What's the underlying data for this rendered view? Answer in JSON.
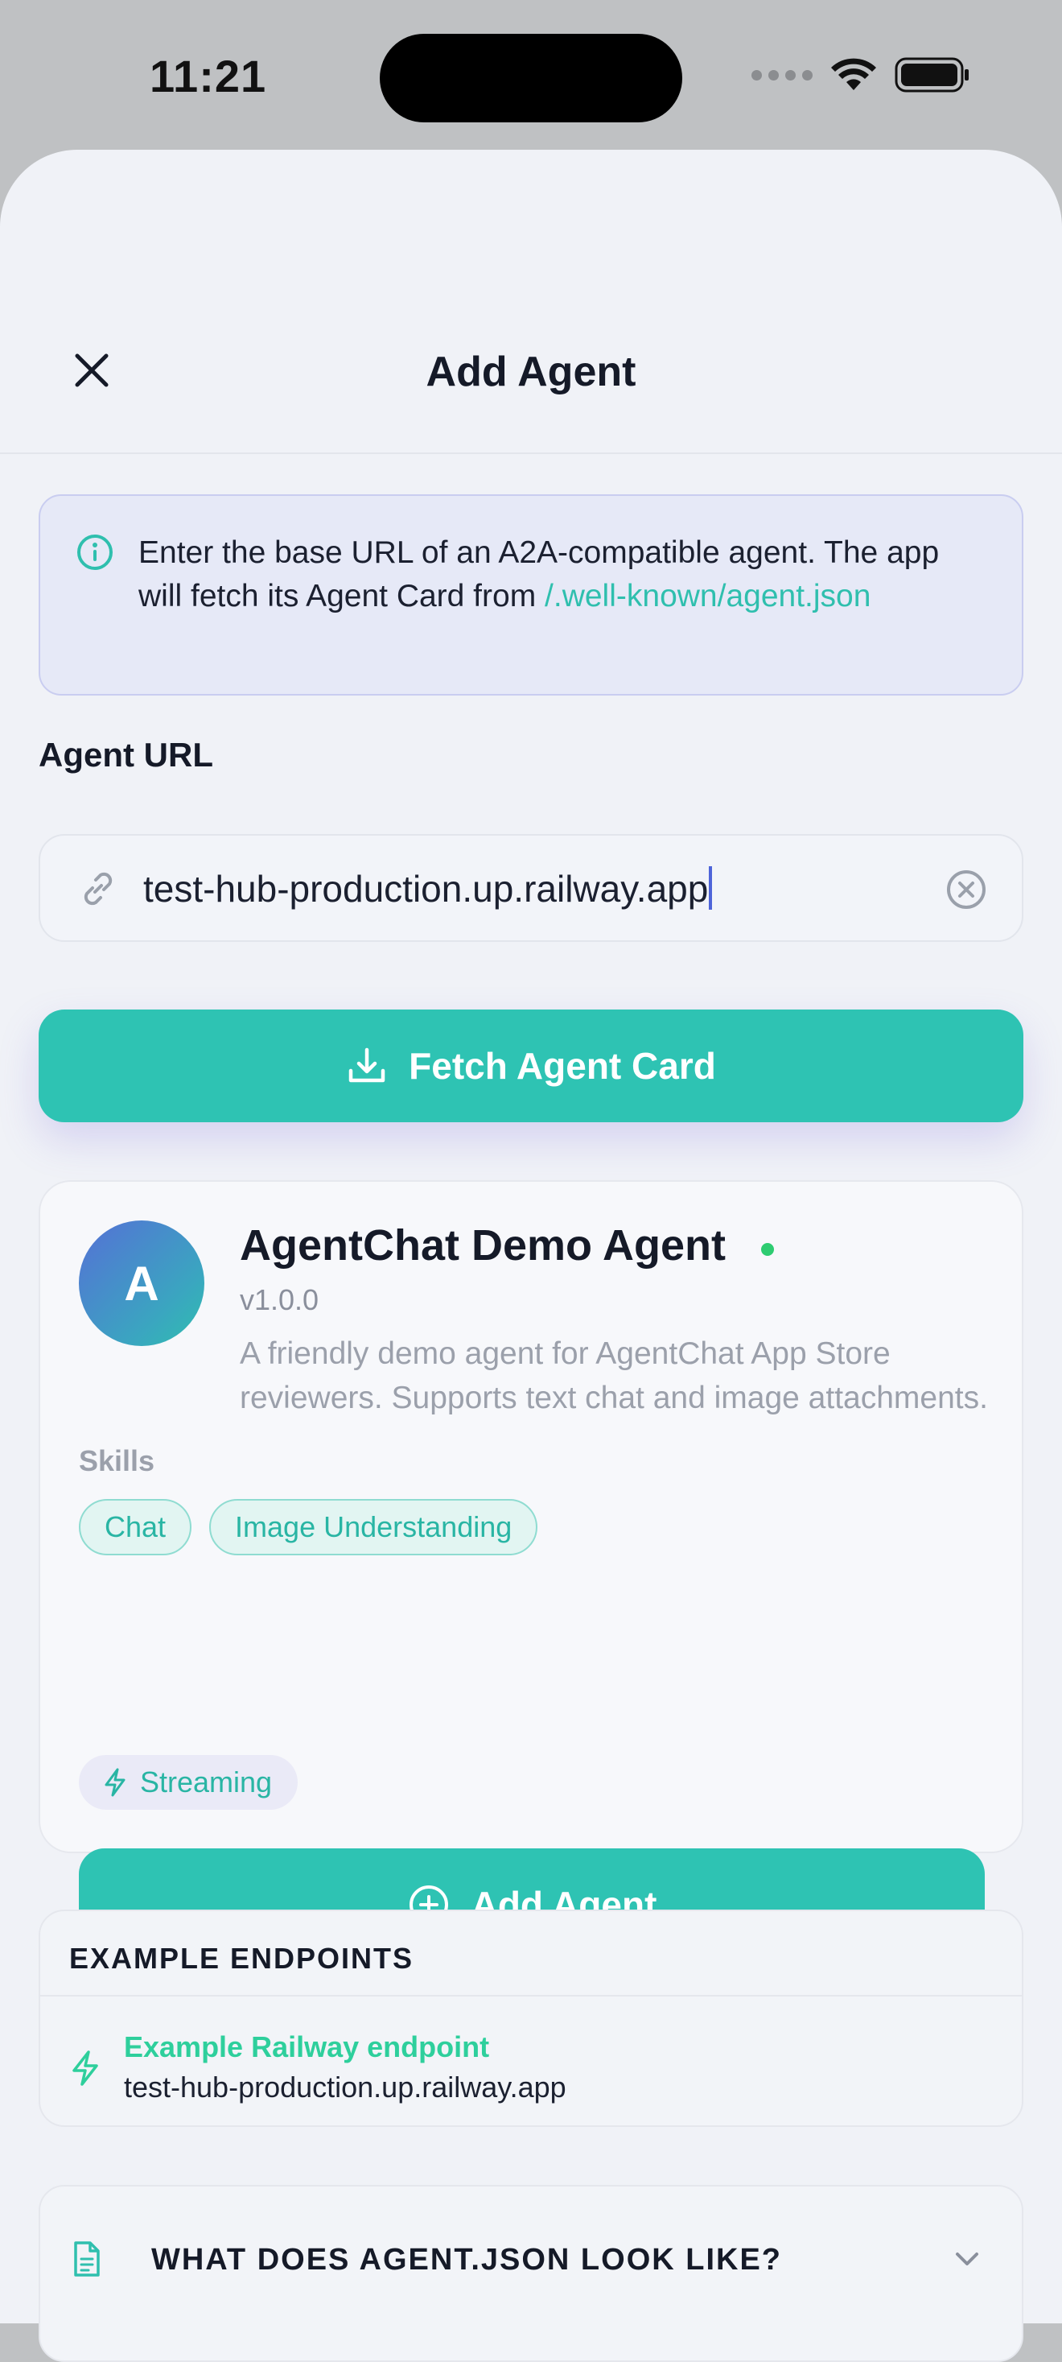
{
  "status_bar": {
    "time": "11:21"
  },
  "nav": {
    "title": "Add Agent"
  },
  "info": {
    "text": "Enter the base URL of an A2A-compatible agent. The app will fetch its Agent Card from ",
    "link": "/.well-known/agent.json"
  },
  "form": {
    "url_label": "Agent URL",
    "url_value": "test-hub-production.up.railway.app",
    "fetch_label": "Fetch Agent Card"
  },
  "agent": {
    "avatar_letter": "A",
    "name": "AgentChat Demo Agent",
    "version": "v1.0.0",
    "description": "A friendly demo agent for AgentChat App Store reviewers. Supports text chat and image attachments.",
    "skills_label": "Skills",
    "skills": [
      "Chat",
      "Image Understanding"
    ],
    "capability": "Streaming",
    "add_label": "Add Agent",
    "status_color": "#2ecc71"
  },
  "examples": {
    "heading": "EXAMPLE ENDPOINTS",
    "items": [
      {
        "title": "Example Railway endpoint",
        "url": "test-hub-production.up.railway.app"
      }
    ]
  },
  "json_section": {
    "title": "WHAT DOES AGENT.JSON LOOK LIKE?"
  },
  "colors": {
    "accent": "#2ec3b3",
    "info_bg": "#e6e9f7",
    "sheet_bg": "#f0f2f7"
  },
  "icons": [
    "close-icon",
    "info-icon",
    "link-icon",
    "clear-icon",
    "download-icon",
    "lightning-icon",
    "plus-circle-icon",
    "document-icon",
    "chevron-down-icon",
    "wifi-icon",
    "battery-icon"
  ]
}
